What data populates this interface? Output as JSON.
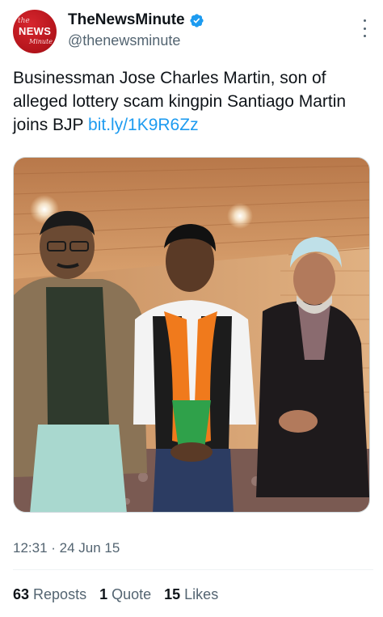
{
  "author": {
    "display_name": "TheNewsMinute",
    "handle": "@thenewsminute",
    "avatar_text": {
      "line1": "the",
      "line2": "NEWS",
      "line3": "Minute"
    },
    "verified_icon": "verified-badge-icon",
    "more_icon": "more-vertical-icon"
  },
  "tweet": {
    "text": "Businessman Jose Charles Martin, son of alleged lottery scam kingpin Santiago Martin joins BJP",
    "link": "bit.ly/1K9R6Zz",
    "timestamp": "12:31 · 24 Jun 15"
  },
  "stats": {
    "reposts_count": "63",
    "reposts_label": "Reposts",
    "quotes_count": "1",
    "quotes_label": "Quote",
    "likes_count": "15",
    "likes_label": "Likes"
  },
  "colors": {
    "accent": "#1d9bf0",
    "secondary_text": "#536471",
    "avatar_red": "#c8161e",
    "verified_blue": "#1d9bf0"
  }
}
